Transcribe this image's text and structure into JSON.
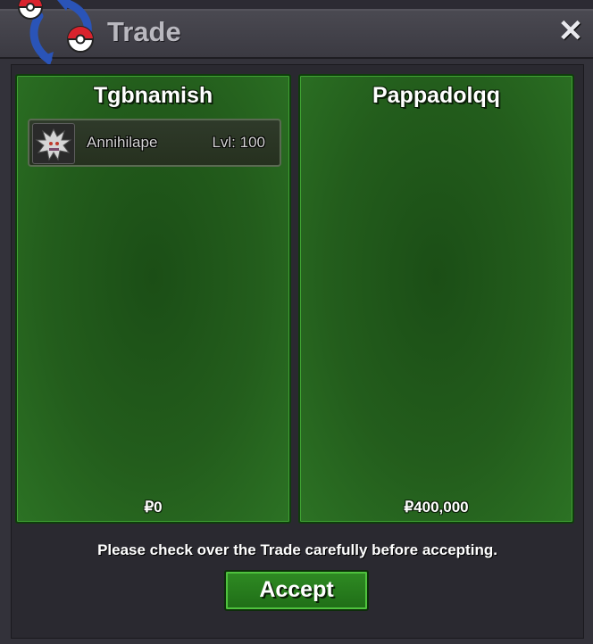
{
  "window": {
    "title": "Trade",
    "close_symbol": "✕"
  },
  "icons": {
    "logo": "trade-arrows-pokeball-icon",
    "close": "close-icon",
    "pokemon_sprite": "annihilape-sprite-icon"
  },
  "colors": {
    "panel_green": "#235d1c",
    "button_green": "#2f8b23",
    "background": "#2c2b33"
  },
  "left_panel": {
    "player_name": "Tgbnamish",
    "money": "₽0",
    "pokemon": [
      {
        "name": "Annihilape",
        "level": "Lvl: 100"
      }
    ]
  },
  "right_panel": {
    "player_name": "Pappadolqq",
    "money": "₽400,000",
    "pokemon": []
  },
  "notice": "Please check over the Trade carefully before accepting.",
  "accept_label": "Accept"
}
